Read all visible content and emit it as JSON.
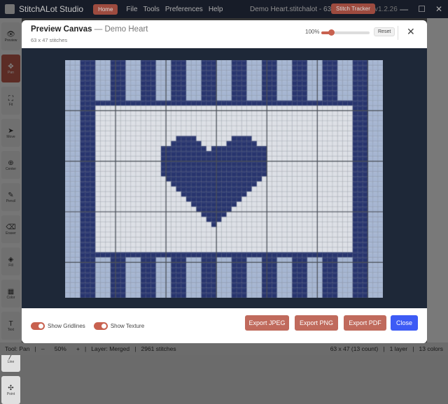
{
  "app": {
    "title": "StitchALot Studio",
    "home": "Home",
    "menu": [
      "File",
      "Tools",
      "Preferences",
      "Help"
    ],
    "document": "Demo Heart.stitchalot - 63 x 47",
    "tracker": "Stitch Tracker",
    "version": "v1.2.26",
    "controls": {
      "minimize": "—",
      "maximize": "☐",
      "close": "✕"
    }
  },
  "toolbar": [
    {
      "label": "Preview",
      "icon": "👁"
    },
    {
      "label": "Pan",
      "icon": "✥",
      "active": true
    },
    {
      "label": "Fit",
      "icon": "⛶"
    },
    {
      "label": "Move",
      "icon": "➤"
    },
    {
      "label": "Center",
      "icon": "⊕"
    },
    {
      "label": "Pencil",
      "icon": "✎"
    },
    {
      "label": "Eraser",
      "icon": "⌫"
    },
    {
      "label": "Fill",
      "icon": "◈"
    },
    {
      "label": "Color",
      "icon": "▦"
    },
    {
      "label": "Text",
      "icon": "T"
    },
    {
      "label": "Line",
      "icon": "╱"
    },
    {
      "label": "Point",
      "icon": "✣"
    }
  ],
  "modal": {
    "title": "Preview Canvas",
    "subtitle": "— Demo Heart",
    "size": "63 x 47 stitches",
    "zoom": "100%",
    "zoom_value": 0.1,
    "reset": "Reset",
    "close_icon": "✕",
    "show_gridlines": "Show Gridlines",
    "show_texture": "Show Texture",
    "gridlines_on": true,
    "texture_on": true,
    "export_jpeg": "Export JPEG",
    "export_png": "Export PNG",
    "export_pdf": "Export PDF",
    "close": "Close"
  },
  "pattern": {
    "cols": 63,
    "rows": 47,
    "colors": {
      "dark": "#27346e",
      "light": "#a6b6d2",
      "ground": "#dde0e6",
      "grid": "#8a8f9a",
      "major": "#4a4f58"
    },
    "heart_rows": {
      "15": [
        [
          22,
          25
        ],
        [
          33,
          36
        ]
      ],
      "16": [
        [
          21,
          26
        ],
        [
          32,
          37
        ]
      ],
      "17": [
        [
          19,
          27
        ],
        [
          29,
          39
        ]
      ],
      "18": [
        [
          19,
          39
        ]
      ],
      "19": [
        [
          19,
          39
        ]
      ],
      "20": [
        [
          19,
          39
        ]
      ],
      "21": [
        [
          19,
          39
        ]
      ],
      "22": [
        [
          19,
          39
        ]
      ],
      "23": [
        [
          20,
          38
        ]
      ],
      "24": [
        [
          21,
          37
        ]
      ],
      "25": [
        [
          22,
          36
        ]
      ],
      "26": [
        [
          23,
          35
        ]
      ],
      "27": [
        [
          24,
          34
        ]
      ],
      "28": [
        [
          25,
          33
        ]
      ],
      "29": [
        [
          26,
          32
        ]
      ],
      "30": [
        [
          27,
          31
        ]
      ],
      "31": [
        [
          28,
          30
        ]
      ],
      "32": [
        [
          29,
          29
        ]
      ]
    }
  },
  "status": {
    "tool": "Tool: Pan",
    "minus": "–",
    "zoom": "50%",
    "plus": "+",
    "layer": "Layer: Merged",
    "stitches": "2961 stitches",
    "dims": "63 x 47 (13 count)",
    "layers": "1 layer",
    "colors": "13 colors"
  }
}
